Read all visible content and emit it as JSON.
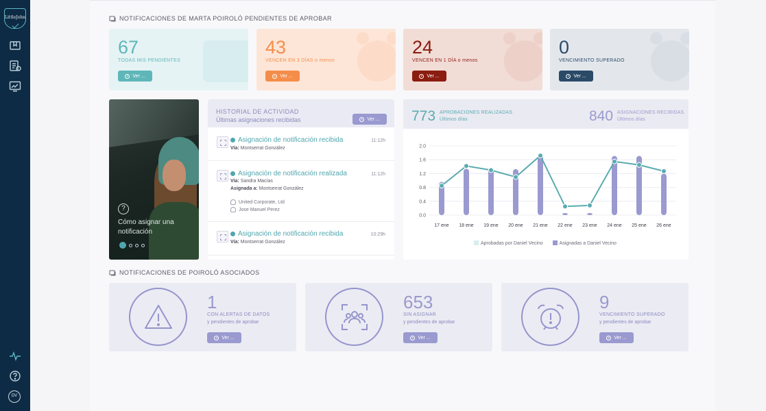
{
  "sidebar": {
    "logo_text": "LittleJohn",
    "avatar_initials": "DV"
  },
  "section1": {
    "title": "NOTIFICACIONES DE MARTA POIROLÓ PENDIENTES DE APROBAR"
  },
  "stats": [
    {
      "value": "67",
      "label": "TODAS MIS PENDIENTES",
      "button": "Ver ...",
      "color": "#5fb6b9",
      "bg": "#e5f3f4"
    },
    {
      "value": "43",
      "label": "VENCEN EN 3 DÍAS o menos",
      "button": "Ver ...",
      "color": "#f58d4a",
      "bg": "#fde6d7"
    },
    {
      "value": "24",
      "label": "VENCEN EN 1 DÍA o menos",
      "button": "Ver ...",
      "color": "#8b1c10",
      "bg": "#f2dcd6"
    },
    {
      "value": "0",
      "label": "VENCIMIENTO SUPERADO",
      "button": "Ver ...",
      "color": "#2b4a68",
      "bg": "#e3e7ec"
    }
  ],
  "promo": {
    "caption": "Cómo asignar una notificación",
    "help_icon": "?"
  },
  "activity": {
    "title": "HISTORIAL DE ACTIVIDAD",
    "subtitle": "Últimas asignaciones recibidas",
    "button": "Ver ...",
    "items": [
      {
        "title": "Asignación de notificación recibida",
        "time": "11:12h",
        "via_label": "Vía:",
        "via": "Montserrat González"
      },
      {
        "title": "Asignación de notificación realizada",
        "time": "11:12h",
        "via_label": "Vía:",
        "via": "Sandra Macías",
        "assigned_label": "Asignada a:",
        "assigned": "Montserrat González",
        "company": "United Corporate, Ltd",
        "person": "Jose Manuel Perez"
      },
      {
        "title": "Asignación de notificación recibida",
        "time": "10:29h",
        "via_label": "Vía:",
        "via": "Montserrat González"
      }
    ]
  },
  "kpis": {
    "done_value": "773",
    "done_label1": "APROBACIONES REALIZADAS",
    "done_label2": "Últimos días",
    "received_value": "840",
    "received_label1": "ASIGNACIONES RECIBIDAS",
    "received_label2": "Últimos días"
  },
  "chart_data": {
    "type": "bar",
    "categories": [
      "17 ene",
      "18 ene",
      "19 ene",
      "20 ene",
      "21 ene",
      "22 ene",
      "23 ene",
      "24 ene",
      "25 ene",
      "26 ene"
    ],
    "series": [
      {
        "name": "Aprobadas por Daniel Vecino",
        "type": "line",
        "color": "#5aabb0",
        "values": [
          0.85,
          1.42,
          1.3,
          1.1,
          1.72,
          0.25,
          0.28,
          1.55,
          1.45,
          1.27
        ]
      },
      {
        "name": "Asignadas a Daniel Vecino",
        "type": "bar",
        "color": "#9a9ad0",
        "values": [
          0.9,
          1.28,
          1.3,
          1.27,
          1.68,
          0.0,
          0.0,
          1.65,
          1.65,
          1.14
        ]
      }
    ],
    "ylim": [
      0,
      2.0
    ],
    "yticks": [
      "0.0",
      "0.4",
      "0.8",
      "1.2",
      "1.6",
      "2.0"
    ],
    "legend_position": "bottom",
    "grid": true
  },
  "section2": {
    "title": "NOTIFICACIONES DE POIROLÓ ASOCIADOS"
  },
  "bottom_cards": [
    {
      "value": "1",
      "line1": "CON ALERTAS DE DATOS",
      "line2": "y pendientes de aprobar",
      "button": "Ver ...",
      "icon": "warning-icon"
    },
    {
      "value": "653",
      "line1": "SIN ASIGNAR",
      "line2": "y pendientes de aprobar",
      "button": "Ver ...",
      "icon": "group-icon"
    },
    {
      "value": "9",
      "line1": "VENCIMIENTO SUPERADO",
      "line2": "y pendientes de aprobar",
      "button": "Ver ...",
      "icon": "alarm-clock-icon"
    }
  ]
}
